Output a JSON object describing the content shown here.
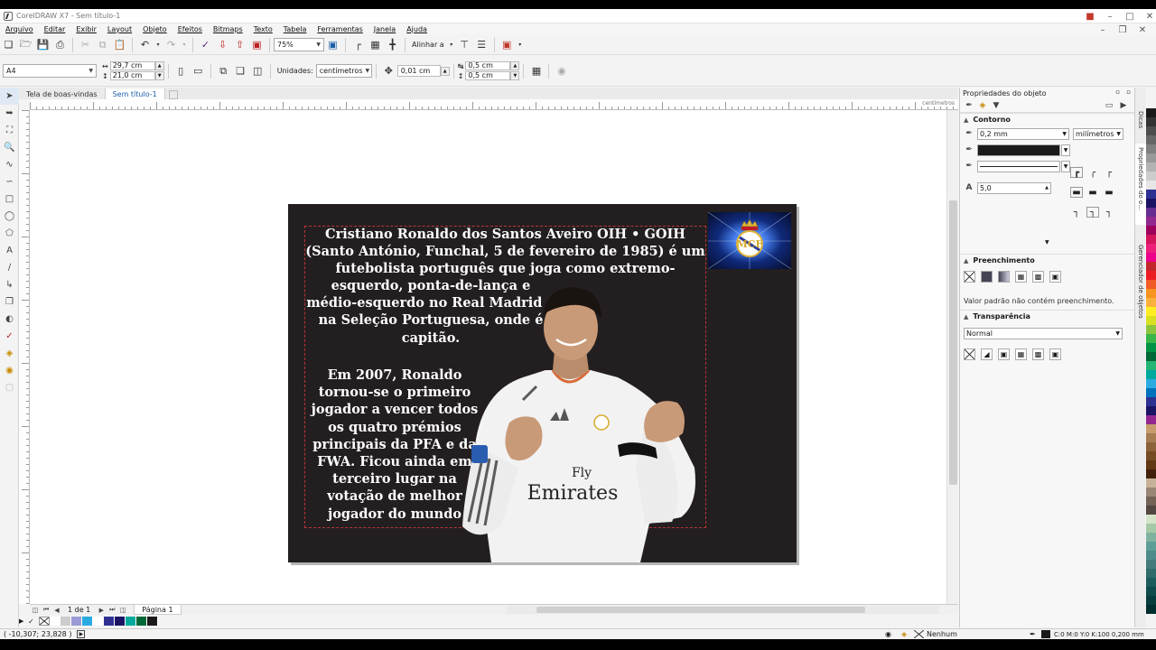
{
  "app": {
    "title": "CorelDRAW X7 - Sem título-1"
  },
  "menu": [
    "Arquivo",
    "Editar",
    "Exibir",
    "Layout",
    "Objeto",
    "Efeitos",
    "Bitmaps",
    "Texto",
    "Tabela",
    "Ferramentas",
    "Janela",
    "Ajuda"
  ],
  "toolbar1": {
    "zoom": "75%",
    "align_label": "Alinhar a"
  },
  "toolbar2": {
    "page_size": "A4",
    "width": "29,7 cm",
    "height": "21,0 cm",
    "units_label": "Unidades:",
    "units_value": "centímetros",
    "nudge": "0,01 cm",
    "dup_x": "0,5 cm",
    "dup_y": "0,5 cm"
  },
  "doc_tabs": [
    "Tela de boas-vindas",
    "Sem título-1"
  ],
  "ruler": {
    "unit": "centímetros"
  },
  "page_content": {
    "para1_top": "Cristiano Ronaldo dos Santos Aveiro OIH • GOIH (Santo António, Funchal, 5 de fevereiro de 1985) é um futebolista português que joga como extremo-",
    "para1_rest": "esquerdo, ponta-de-lança e médio-esquerdo no Real Madrid e na Seleção Portuguesa, onde é capitão.",
    "para2": "Em 2007, Ronaldo tornou-se o primeiro jogador a vencer todos os quatro prémios principais da PFA e da FWA. Ficou ainda em terceiro lugar na votação de melhor jogador do mundo",
    "shirt_text": "Fly Emirates"
  },
  "page_nav": {
    "count": "1 de 1",
    "tab": "Página 1"
  },
  "status": {
    "coords": "( -10,307; 23,828 )",
    "fill": "Nenhum",
    "outline": "C:0 M:0 Y:0 K:100  0,200 mm"
  },
  "docker": {
    "title": "Propriedades do objeto",
    "outline_header": "Contorno",
    "outline_width": "0,2 mm",
    "outline_units": "milímetros",
    "miter": "5,0",
    "more": "...",
    "fill_header": "Preenchimento",
    "fill_note": "Valor padrão não contém preenchimento.",
    "transparency_header": "Transparência",
    "transparency_mode": "Normal"
  },
  "side_tabs": [
    "Dicas",
    "Propriedades do o...",
    "Gerenciador de objetos"
  ],
  "colors": {
    "page_bg": "#231f20",
    "frame": "#b33333",
    "active_tab": "#1b5ea8"
  },
  "palette_bottom": [
    "#ffffff",
    "#cccccc",
    "#9a9ad4",
    "#29abe2",
    "#ffffff",
    "#2e3192",
    "#1b1464",
    "#00a99d",
    "#006837",
    "#1a1a1a"
  ],
  "palette_right": [
    "#1a1a1a",
    "#333333",
    "#4d4d4d",
    "#666666",
    "#808080",
    "#999999",
    "#b3b3b3",
    "#cccccc",
    "#e6e6e6",
    "#2e3192",
    "#1b1464",
    "#662d91",
    "#92278f",
    "#9e005d",
    "#d4145a",
    "#ed1e79",
    "#ec008c",
    "#c1272d",
    "#ed1c24",
    "#f15a24",
    "#f7931e",
    "#fbb03b",
    "#fcee21",
    "#d9e021",
    "#8cc63f",
    "#39b54a",
    "#009245",
    "#006837",
    "#22b573",
    "#00a99d",
    "#29abe2",
    "#0071bc",
    "#2e3192",
    "#1b1464",
    "#93278f",
    "#c69c6d",
    "#a67c52",
    "#8c6239",
    "#754c24",
    "#603813",
    "#42210b",
    "#c7b299",
    "#998675",
    "#736357",
    "#534741",
    "#d4e4c9",
    "#a4c9a5",
    "#7fb3a0",
    "#5d9e96",
    "#4f8b8b",
    "#437a7a",
    "#2f6b6b",
    "#1c5c5c",
    "#104c4c",
    "#083d3d",
    "#002f2f"
  ]
}
